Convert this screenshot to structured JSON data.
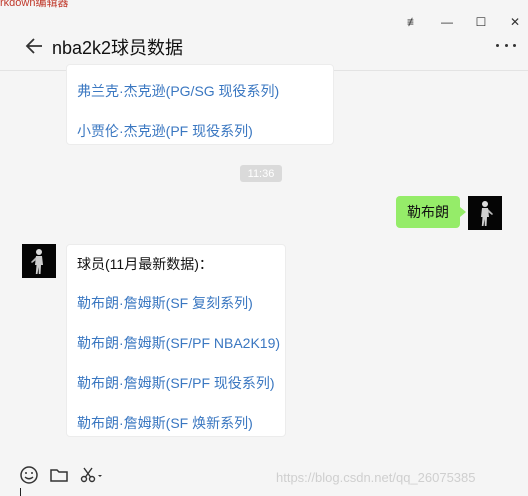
{
  "background_tab": {
    "text": "rkdown编辑器"
  },
  "window": {
    "pin_glyph": "≢",
    "minimize_glyph": "—",
    "maximize_glyph": "☐",
    "close_glyph": "✕"
  },
  "header": {
    "title": "nba2k2球员数据"
  },
  "messages": {
    "top_links": [
      "弗兰克·杰克逊(PG/SG 现役系列)",
      "小贾伦·杰克逊(PF 现役系列)"
    ],
    "timestamp": "11:36",
    "user_message": "勒布朗",
    "reply_heading": "球员(11月最新数据)：",
    "reply_links": [
      "勒布朗·詹姆斯(SF 复刻系列)",
      "勒布朗·詹姆斯(SF/PF NBA2K19)",
      "勒布朗·詹姆斯(SF/PF 现役系列)",
      "勒布朗·詹姆斯(SF 焕新系列)"
    ]
  },
  "footer": {
    "watermark": "https://blog.csdn.net/qq_26075385"
  },
  "colors": {
    "link": "#3a77c1",
    "my_bubble": "#95ec69",
    "timestamp_bg": "#dadada"
  },
  "icons": [
    "back-arrow-icon",
    "more-icon",
    "emoji-icon",
    "folder-icon",
    "scissors-icon",
    "player-avatar"
  ]
}
